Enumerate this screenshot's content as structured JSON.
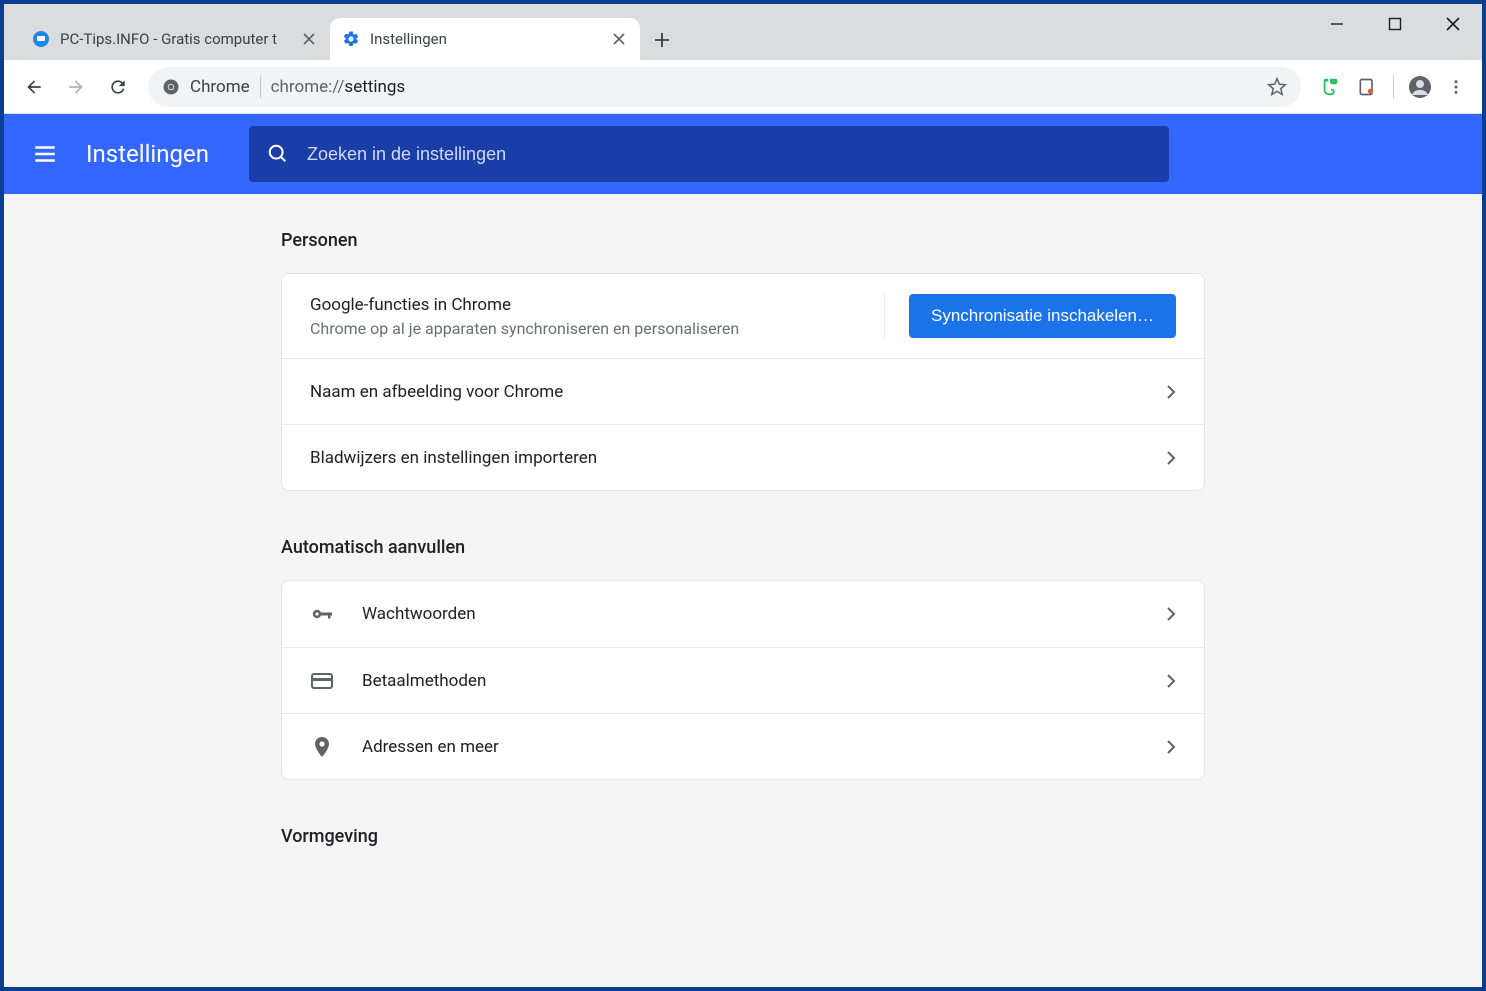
{
  "window": {
    "tabs": [
      {
        "title": "PC-Tips.INFO - Gratis computer t",
        "active": false
      },
      {
        "title": "Instellingen",
        "active": true
      }
    ]
  },
  "omnibox": {
    "label": "Chrome",
    "url_prefix": "chrome://",
    "url_path": "settings"
  },
  "settings_header": {
    "title": "Instellingen",
    "search_placeholder": "Zoeken in de instellingen"
  },
  "sections": {
    "personen": {
      "title": "Personen",
      "google_features_title": "Google-functies in Chrome",
      "google_features_sub": "Chrome op al je apparaten synchroniseren en personaliseren",
      "sync_button": "Synchronisatie inschakelen…",
      "row_name_image": "Naam en afbeelding voor Chrome",
      "row_import": "Bladwijzers en instellingen importeren"
    },
    "autofill": {
      "title": "Automatisch aanvullen",
      "row_passwords": "Wachtwoorden",
      "row_payment": "Betaalmethoden",
      "row_addresses": "Adressen en meer"
    },
    "appearance": {
      "title": "Vormgeving"
    }
  }
}
